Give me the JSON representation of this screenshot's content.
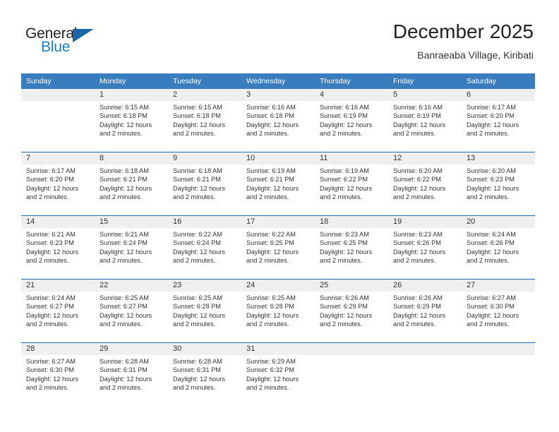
{
  "brand": {
    "name_part1": "General",
    "name_part2": "Blue",
    "triangle_color": "#1866a8",
    "blue_color": "#1a7fc1"
  },
  "header": {
    "title": "December 2025",
    "subtitle": "Banraeaba Village, Kiribati"
  },
  "colors": {
    "header_row_bg": "#3a7dbf",
    "daynum_bg": "#efefef",
    "row_divider": "#1f6db5",
    "text": "#333333"
  },
  "weekday_headers": [
    "Sunday",
    "Monday",
    "Tuesday",
    "Wednesday",
    "Thursday",
    "Friday",
    "Saturday"
  ],
  "weeks": [
    [
      {
        "day": "",
        "sunrise": "",
        "sunset": "",
        "daylight1": "",
        "daylight2": ""
      },
      {
        "day": "1",
        "sunrise": "Sunrise: 6:15 AM",
        "sunset": "Sunset: 6:18 PM",
        "daylight1": "Daylight: 12 hours",
        "daylight2": "and 2 minutes."
      },
      {
        "day": "2",
        "sunrise": "Sunrise: 6:15 AM",
        "sunset": "Sunset: 6:18 PM",
        "daylight1": "Daylight: 12 hours",
        "daylight2": "and 2 minutes."
      },
      {
        "day": "3",
        "sunrise": "Sunrise: 6:16 AM",
        "sunset": "Sunset: 6:18 PM",
        "daylight1": "Daylight: 12 hours",
        "daylight2": "and 2 minutes."
      },
      {
        "day": "4",
        "sunrise": "Sunrise: 6:16 AM",
        "sunset": "Sunset: 6:19 PM",
        "daylight1": "Daylight: 12 hours",
        "daylight2": "and 2 minutes."
      },
      {
        "day": "5",
        "sunrise": "Sunrise: 6:16 AM",
        "sunset": "Sunset: 6:19 PM",
        "daylight1": "Daylight: 12 hours",
        "daylight2": "and 2 minutes."
      },
      {
        "day": "6",
        "sunrise": "Sunrise: 6:17 AM",
        "sunset": "Sunset: 6:20 PM",
        "daylight1": "Daylight: 12 hours",
        "daylight2": "and 2 minutes."
      }
    ],
    [
      {
        "day": "7",
        "sunrise": "Sunrise: 6:17 AM",
        "sunset": "Sunset: 6:20 PM",
        "daylight1": "Daylight: 12 hours",
        "daylight2": "and 2 minutes."
      },
      {
        "day": "8",
        "sunrise": "Sunrise: 6:18 AM",
        "sunset": "Sunset: 6:21 PM",
        "daylight1": "Daylight: 12 hours",
        "daylight2": "and 2 minutes."
      },
      {
        "day": "9",
        "sunrise": "Sunrise: 6:18 AM",
        "sunset": "Sunset: 6:21 PM",
        "daylight1": "Daylight: 12 hours",
        "daylight2": "and 2 minutes."
      },
      {
        "day": "10",
        "sunrise": "Sunrise: 6:19 AM",
        "sunset": "Sunset: 6:21 PM",
        "daylight1": "Daylight: 12 hours",
        "daylight2": "and 2 minutes."
      },
      {
        "day": "11",
        "sunrise": "Sunrise: 6:19 AM",
        "sunset": "Sunset: 6:22 PM",
        "daylight1": "Daylight: 12 hours",
        "daylight2": "and 2 minutes."
      },
      {
        "day": "12",
        "sunrise": "Sunrise: 6:20 AM",
        "sunset": "Sunset: 6:22 PM",
        "daylight1": "Daylight: 12 hours",
        "daylight2": "and 2 minutes."
      },
      {
        "day": "13",
        "sunrise": "Sunrise: 6:20 AM",
        "sunset": "Sunset: 6:23 PM",
        "daylight1": "Daylight: 12 hours",
        "daylight2": "and 2 minutes."
      }
    ],
    [
      {
        "day": "14",
        "sunrise": "Sunrise: 6:21 AM",
        "sunset": "Sunset: 6:23 PM",
        "daylight1": "Daylight: 12 hours",
        "daylight2": "and 2 minutes."
      },
      {
        "day": "15",
        "sunrise": "Sunrise: 6:21 AM",
        "sunset": "Sunset: 6:24 PM",
        "daylight1": "Daylight: 12 hours",
        "daylight2": "and 2 minutes."
      },
      {
        "day": "16",
        "sunrise": "Sunrise: 6:22 AM",
        "sunset": "Sunset: 6:24 PM",
        "daylight1": "Daylight: 12 hours",
        "daylight2": "and 2 minutes."
      },
      {
        "day": "17",
        "sunrise": "Sunrise: 6:22 AM",
        "sunset": "Sunset: 6:25 PM",
        "daylight1": "Daylight: 12 hours",
        "daylight2": "and 2 minutes."
      },
      {
        "day": "18",
        "sunrise": "Sunrise: 6:23 AM",
        "sunset": "Sunset: 6:25 PM",
        "daylight1": "Daylight: 12 hours",
        "daylight2": "and 2 minutes."
      },
      {
        "day": "19",
        "sunrise": "Sunrise: 6:23 AM",
        "sunset": "Sunset: 6:26 PM",
        "daylight1": "Daylight: 12 hours",
        "daylight2": "and 2 minutes."
      },
      {
        "day": "20",
        "sunrise": "Sunrise: 6:24 AM",
        "sunset": "Sunset: 6:26 PM",
        "daylight1": "Daylight: 12 hours",
        "daylight2": "and 2 minutes."
      }
    ],
    [
      {
        "day": "21",
        "sunrise": "Sunrise: 6:24 AM",
        "sunset": "Sunset: 6:27 PM",
        "daylight1": "Daylight: 12 hours",
        "daylight2": "and 2 minutes."
      },
      {
        "day": "22",
        "sunrise": "Sunrise: 6:25 AM",
        "sunset": "Sunset: 6:27 PM",
        "daylight1": "Daylight: 12 hours",
        "daylight2": "and 2 minutes."
      },
      {
        "day": "23",
        "sunrise": "Sunrise: 6:25 AM",
        "sunset": "Sunset: 6:28 PM",
        "daylight1": "Daylight: 12 hours",
        "daylight2": "and 2 minutes."
      },
      {
        "day": "24",
        "sunrise": "Sunrise: 6:25 AM",
        "sunset": "Sunset: 6:28 PM",
        "daylight1": "Daylight: 12 hours",
        "daylight2": "and 2 minutes."
      },
      {
        "day": "25",
        "sunrise": "Sunrise: 6:26 AM",
        "sunset": "Sunset: 6:29 PM",
        "daylight1": "Daylight: 12 hours",
        "daylight2": "and 2 minutes."
      },
      {
        "day": "26",
        "sunrise": "Sunrise: 6:26 AM",
        "sunset": "Sunset: 6:29 PM",
        "daylight1": "Daylight: 12 hours",
        "daylight2": "and 2 minutes."
      },
      {
        "day": "27",
        "sunrise": "Sunrise: 6:27 AM",
        "sunset": "Sunset: 6:30 PM",
        "daylight1": "Daylight: 12 hours",
        "daylight2": "and 2 minutes."
      }
    ],
    [
      {
        "day": "28",
        "sunrise": "Sunrise: 6:27 AM",
        "sunset": "Sunset: 6:30 PM",
        "daylight1": "Daylight: 12 hours",
        "daylight2": "and 2 minutes."
      },
      {
        "day": "29",
        "sunrise": "Sunrise: 6:28 AM",
        "sunset": "Sunset: 6:31 PM",
        "daylight1": "Daylight: 12 hours",
        "daylight2": "and 2 minutes."
      },
      {
        "day": "30",
        "sunrise": "Sunrise: 6:28 AM",
        "sunset": "Sunset: 6:31 PM",
        "daylight1": "Daylight: 12 hours",
        "daylight2": "and 2 minutes."
      },
      {
        "day": "31",
        "sunrise": "Sunrise: 6:29 AM",
        "sunset": "Sunset: 6:32 PM",
        "daylight1": "Daylight: 12 hours",
        "daylight2": "and 2 minutes."
      },
      {
        "day": "",
        "sunrise": "",
        "sunset": "",
        "daylight1": "",
        "daylight2": ""
      },
      {
        "day": "",
        "sunrise": "",
        "sunset": "",
        "daylight1": "",
        "daylight2": ""
      },
      {
        "day": "",
        "sunrise": "",
        "sunset": "",
        "daylight1": "",
        "daylight2": ""
      }
    ]
  ]
}
